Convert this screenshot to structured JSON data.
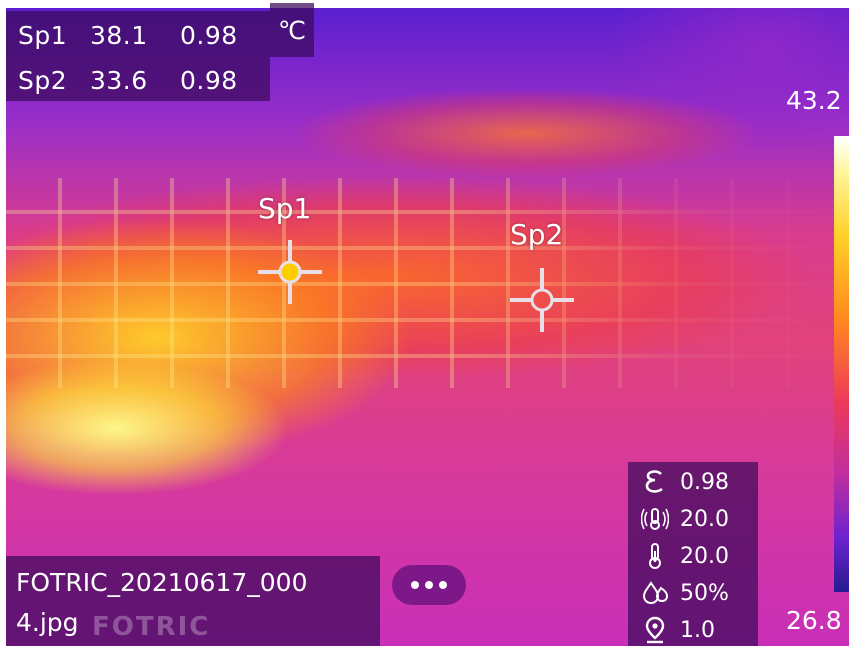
{
  "spots": [
    {
      "name": "Sp1",
      "temp": "38.1",
      "emissivity": "0.98"
    },
    {
      "name": "Sp2",
      "temp": "33.6",
      "emissivity": "0.98"
    }
  ],
  "unit": "℃",
  "markers": [
    {
      "label": "Sp1"
    },
    {
      "label": "Sp2"
    }
  ],
  "scale": {
    "max": "43.2",
    "min": "26.8"
  },
  "params": {
    "emissivity": {
      "icon": "emissivity-icon",
      "value": "0.98"
    },
    "reflected_temp": {
      "icon": "reflected-temperature-icon",
      "value": "20.0"
    },
    "ambient_temp": {
      "icon": "thermometer-icon",
      "value": "20.0"
    },
    "humidity": {
      "icon": "humidity-icon",
      "value": "50%"
    },
    "distance": {
      "icon": "location-distance-icon",
      "value": "1.0"
    }
  },
  "file": {
    "name_line1": "FOTRIC_20210617_000",
    "name_line2": "4.jpg"
  },
  "watermark": "FOTRIC",
  "colors": {
    "overlay": "#3c0a5a",
    "marker_center": "#ffcc00"
  }
}
